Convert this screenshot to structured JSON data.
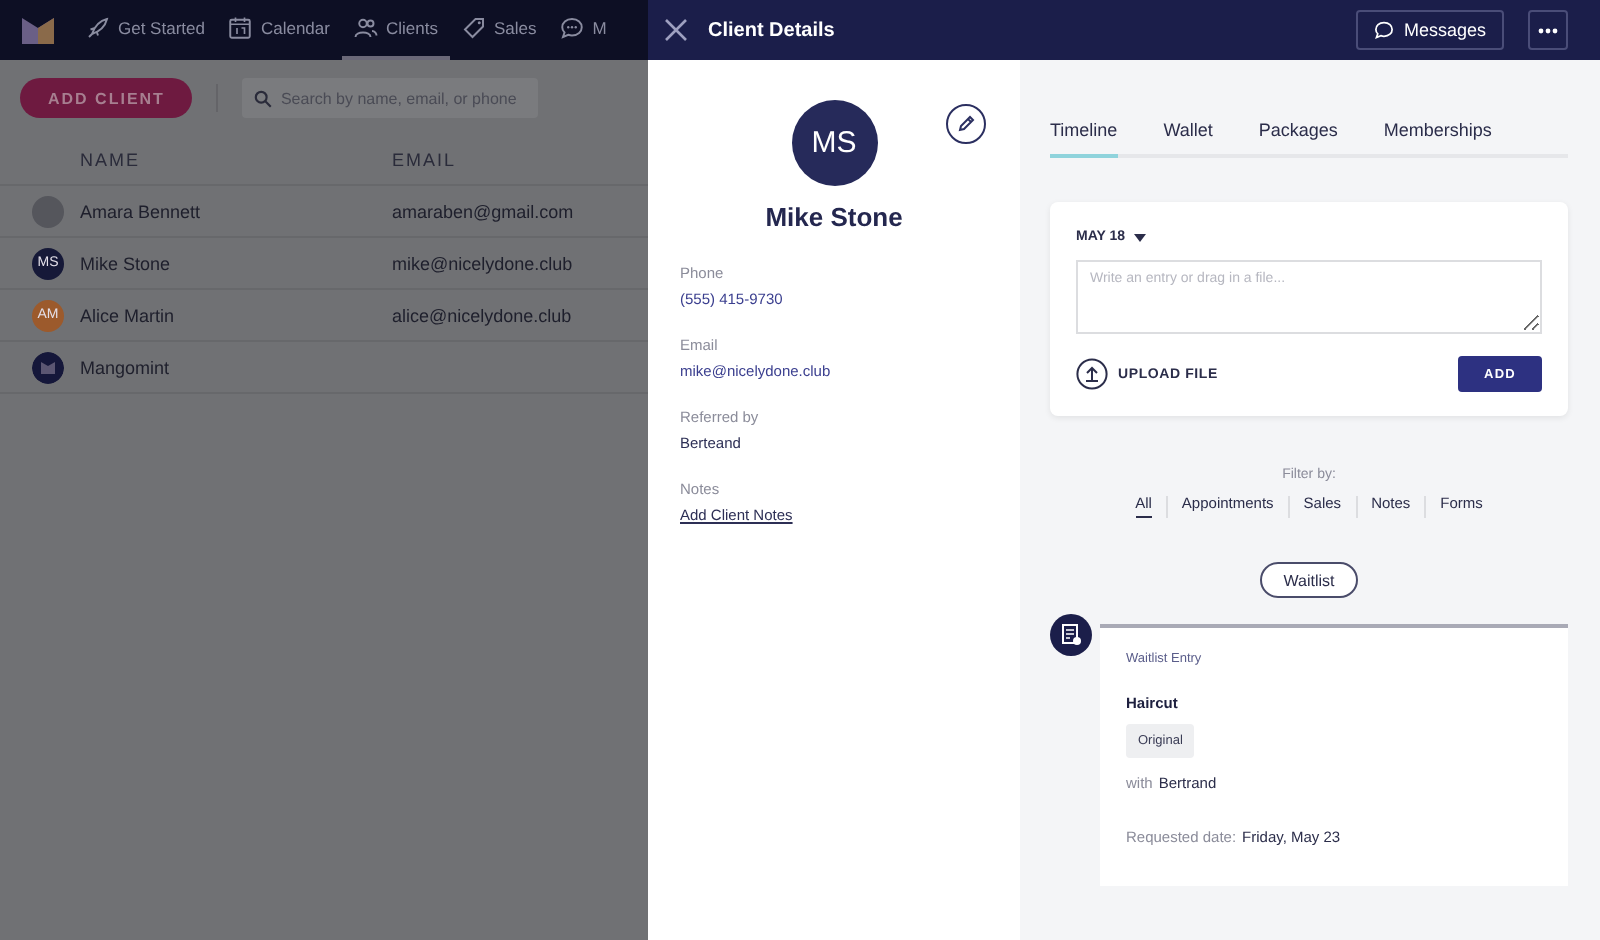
{
  "app": {
    "nav": [
      {
        "label": "Get Started",
        "selected": false
      },
      {
        "label": "Calendar",
        "selected": false
      },
      {
        "label": "Clients",
        "selected": true
      },
      {
        "label": "Sales",
        "selected": false
      },
      {
        "label": "M",
        "selected": false
      }
    ],
    "add_client": "ADD CLIENT",
    "search": {
      "placeholder": "Search by name, email, or phone"
    },
    "columns": [
      "NAME",
      "EMAIL"
    ],
    "rows": [
      {
        "name": "Amara Bennett",
        "email": "amaraben@gmail.com",
        "avatar": {
          "kind": "photo"
        }
      },
      {
        "name": "Mike Stone",
        "email": "mike@nicelydone.club",
        "avatar": {
          "kind": "initials",
          "text": "MS",
          "color": "#161938"
        }
      },
      {
        "name": "Alice Martin",
        "email": "alice@nicelydone.club",
        "avatar": {
          "kind": "initials",
          "text": "AM",
          "color": "#9c5a2c"
        }
      },
      {
        "name": "Mangomint",
        "avatar": {
          "kind": "logo"
        }
      }
    ]
  },
  "drawer": {
    "title": "Client Details",
    "messages": "Messages",
    "client": {
      "initials": "MS",
      "name": "Mike Stone"
    },
    "fields": [
      {
        "label": "Phone",
        "value": "(555) 415-9730",
        "kind": "link"
      },
      {
        "label": "Email",
        "value": "mike@nicelydone.club",
        "kind": "link"
      },
      {
        "label": "Referred by",
        "value": "Berteand",
        "kind": "text"
      },
      {
        "label": "Notes",
        "value": "Add Client Notes",
        "kind": "action"
      }
    ],
    "tabs": [
      {
        "label": "Timeline",
        "selected": true
      },
      {
        "label": "Wallet",
        "selected": false
      },
      {
        "label": "Packages",
        "selected": false
      },
      {
        "label": "Memberships",
        "selected": false
      }
    ],
    "composer": {
      "date": "MAY 18",
      "placeholder": "Write an entry or drag in a file...",
      "upload": "UPLOAD FILE",
      "add": "ADD"
    },
    "filter": {
      "label": "Filter by:",
      "options": [
        {
          "label": "All",
          "selected": true
        },
        {
          "label": "Appointments",
          "selected": false
        },
        {
          "label": "Sales",
          "selected": false
        },
        {
          "label": "Notes",
          "selected": false
        },
        {
          "label": "Forms",
          "selected": false
        }
      ]
    },
    "waitlist_button": "Waitlist",
    "entry": {
      "type": "Waitlist Entry",
      "service": "Haircut",
      "tag": "Original",
      "with_label": "with",
      "staff": "Bertrand",
      "date_label": "Requested date:",
      "date": "Friday, May 23"
    }
  }
}
